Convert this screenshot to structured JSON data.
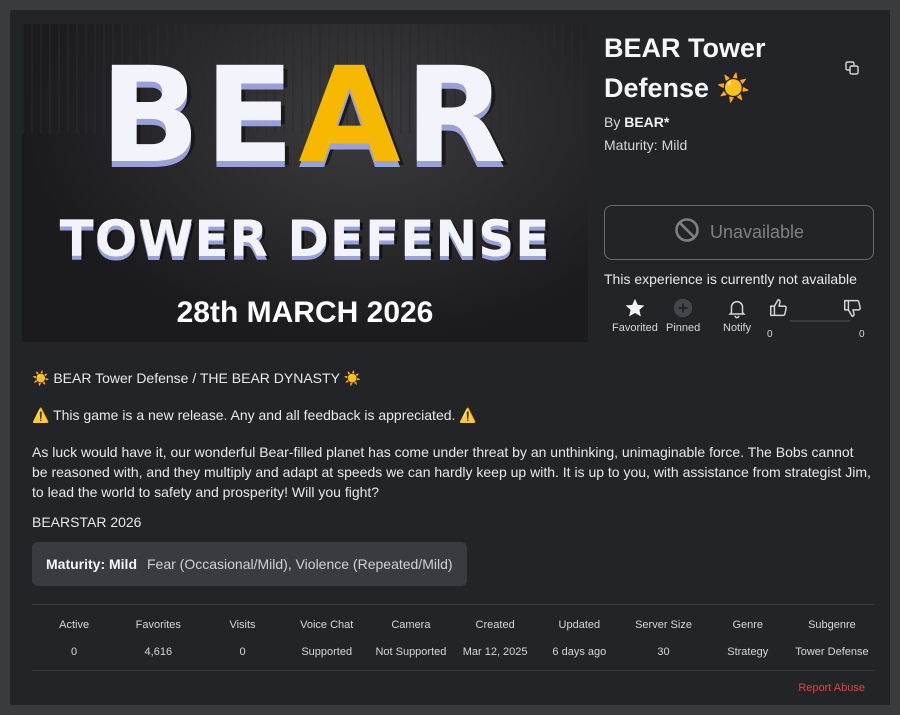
{
  "banner": {
    "logo_main": "BEAR",
    "logo_sub": "TOWER DEFENSE",
    "date": "28th MARCH 2026"
  },
  "game": {
    "title": "BEAR Tower Defense ☀️",
    "by_label": "By",
    "creator": "BEAR*",
    "maturity": "Maturity: Mild"
  },
  "play": {
    "button_label": "Unavailable",
    "status_text": "This experience is currently not available"
  },
  "actions": {
    "favorited": "Favorited",
    "pinned": "Pinned",
    "notify": "Notify",
    "upvotes": "0",
    "downvotes": "0"
  },
  "description": {
    "line1": "☀️ BEAR Tower Defense / THE BEAR DYNASTY ☀️",
    "line2": "⚠️ This game is a new release. Any and all feedback is appreciated. ⚠️",
    "paragraph": "As luck would have it, our wonderful Bear-filled planet has come under threat by an unthinking, unimaginable force. The Bobs cannot be reasoned with, and they multiply and adapt at speeds we can hardly keep up with. It is up to you, with assistance from strategist Jim, to lead the world to safety and prosperity! Will you fight?",
    "line4": "BEARSTAR 2026"
  },
  "maturity_box": {
    "label": "Maturity: Mild",
    "detail": "Fear (Occasional/Mild), Violence (Repeated/Mild)"
  },
  "stats": [
    {
      "label": "Active",
      "value": "0"
    },
    {
      "label": "Favorites",
      "value": "4,616"
    },
    {
      "label": "Visits",
      "value": "0"
    },
    {
      "label": "Voice Chat",
      "value": "Supported"
    },
    {
      "label": "Camera",
      "value": "Not Supported"
    },
    {
      "label": "Created",
      "value": "Mar 12, 2025"
    },
    {
      "label": "Updated",
      "value": "6 days ago"
    },
    {
      "label": "Server Size",
      "value": "30"
    },
    {
      "label": "Genre",
      "value": "Strategy"
    },
    {
      "label": "Subgenre",
      "value": "Tower Defense"
    }
  ],
  "report_label": "Report Abuse",
  "colors": {
    "background": "#232428",
    "report": "#e0453a",
    "accent_yellow": "#f6b800"
  }
}
